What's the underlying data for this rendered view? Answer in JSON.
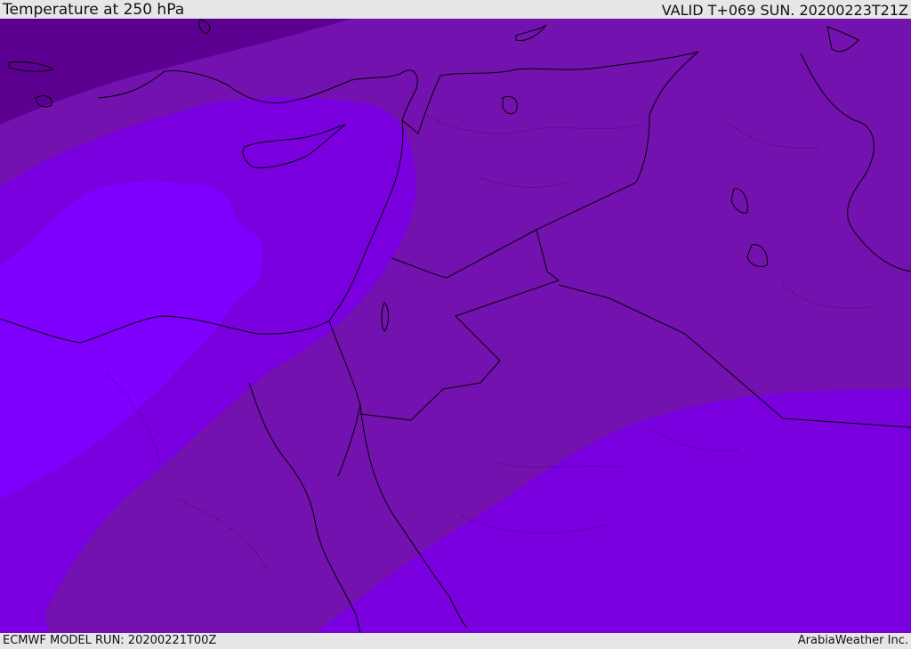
{
  "header": {
    "title": "Temperature at 250 hPa",
    "valid": "VALID T+069 SUN. 20200223T21Z"
  },
  "footer": {
    "model_run": "ECMWF MODEL RUN: 20200221T00Z",
    "credit": "ArabiaWeather Inc."
  },
  "colors": {
    "band_coldest": "#5c0092",
    "band_cold": "#7412af",
    "band_mid": "#7a00e0",
    "band_warm": "#8000ff",
    "coastline": "#000000",
    "background": "#e6e6e6"
  }
}
